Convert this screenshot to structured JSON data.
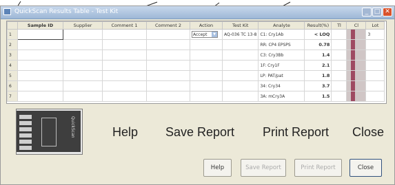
{
  "window": {
    "title": "QuickScan Results Table - Test Kit",
    "controls": [
      "minimize-icon",
      "maximize-icon",
      "close-icon"
    ]
  },
  "grid": {
    "columns": [
      "",
      "Sample ID",
      "Supplier",
      "Comment 1",
      "Comment 2",
      "Action",
      "Test Kit",
      "Analyte",
      "Result(%)",
      "Tl",
      "Cl",
      "Lot"
    ],
    "rows": [
      {
        "num": "1",
        "sample_id": "",
        "supplier": "",
        "comment1": "",
        "comment2": "",
        "action": "Accept",
        "test_kit": "AQ-036 TC 13-8",
        "analyte": "C1: Cry1Ab",
        "result": "< LOQ",
        "lot": "3"
      },
      {
        "num": "2",
        "sample_id": "",
        "supplier": "",
        "comment1": "",
        "comment2": "",
        "action": "",
        "test_kit": "",
        "analyte": "RR: CP4 EPSPS",
        "result": "0.78",
        "lot": ""
      },
      {
        "num": "3",
        "sample_id": "",
        "supplier": "",
        "comment1": "",
        "comment2": "",
        "action": "",
        "test_kit": "",
        "analyte": "C3: Cry3Bb",
        "result": "1.4",
        "lot": ""
      },
      {
        "num": "4",
        "sample_id": "",
        "supplier": "",
        "comment1": "",
        "comment2": "",
        "action": "",
        "test_kit": "",
        "analyte": "1F: Cry1F",
        "result": "2.1",
        "lot": ""
      },
      {
        "num": "5",
        "sample_id": "",
        "supplier": "",
        "comment1": "",
        "comment2": "",
        "action": "",
        "test_kit": "",
        "analyte": "LP: PAT/pat",
        "result": "1.8",
        "lot": ""
      },
      {
        "num": "6",
        "sample_id": "",
        "supplier": "",
        "comment1": "",
        "comment2": "",
        "action": "",
        "test_kit": "",
        "analyte": "34: Cry34",
        "result": "3.7",
        "lot": ""
      },
      {
        "num": "7",
        "sample_id": "",
        "supplier": "",
        "comment1": "",
        "comment2": "",
        "action": "",
        "test_kit": "",
        "analyte": "3A: mCry3A",
        "result": "1.5",
        "lot": ""
      }
    ]
  },
  "thumbnail": {
    "brand": "QuickScan"
  },
  "callouts": {
    "help": "Help",
    "save": "Save Report",
    "print": "Print Report",
    "close": "Close"
  },
  "buttons": {
    "help": "Help",
    "save": "Save Report",
    "print": "Print Report",
    "close": "Close"
  },
  "colors": {
    "strip_band": "#9e4a62",
    "title_gradient": "#9db7d6",
    "close_button": "#d9532c"
  }
}
